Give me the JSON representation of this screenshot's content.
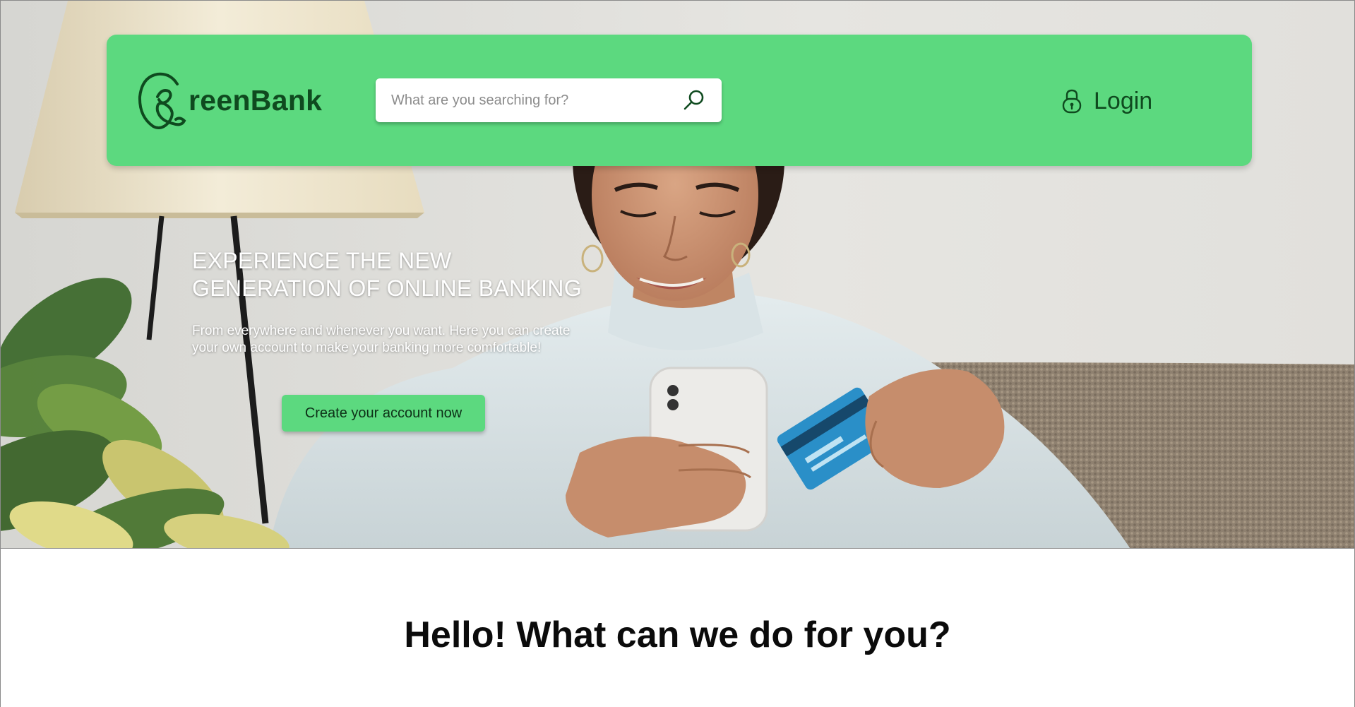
{
  "header": {
    "logo_text": "reenBank",
    "search": {
      "placeholder": "What are you searching for?"
    },
    "login_label": "Login"
  },
  "hero": {
    "title_line1": "EXPERIENCE THE NEW",
    "title_line2": "GENERATION OF ONLINE BANKING",
    "description": "From everywhere and whenever you want. Here you can create your own account to make your banking more comfortable!",
    "cta_label": "Create your account now"
  },
  "section": {
    "greeting": "Hello! What can we do for you?"
  },
  "icons": {
    "logo": "greenbank-g-logo-icon",
    "search": "magnifier-icon",
    "login": "padlock-icon"
  },
  "colors": {
    "brand_green": "#5cd97f",
    "brand_dark_green": "#0f4a1f",
    "hero_text": "#ffffff",
    "heading_text": "#0b0b0b"
  }
}
